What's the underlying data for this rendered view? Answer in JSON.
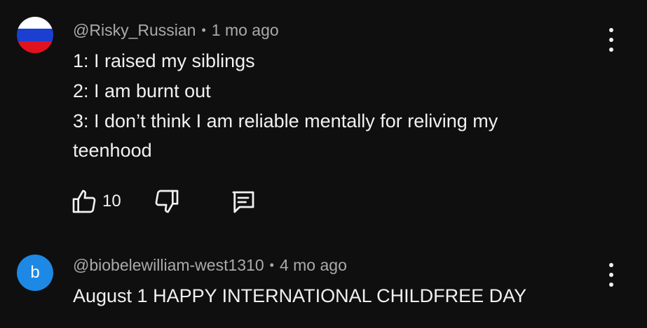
{
  "comments": [
    {
      "author": "@Risky_Russian",
      "time": "1 mo ago",
      "lines": [
        "1: I raised my siblings",
        "2: I am burnt out",
        "3: I don’t think I am reliable mentally for reliving my",
        "teenhood"
      ],
      "likes": "10",
      "avatar": {
        "type": "flag",
        "colors": [
          "#ffffff",
          "#1a3fd1",
          "#e0121f"
        ]
      }
    },
    {
      "author": "@biobelewilliam-west1310",
      "time": "4 mo ago",
      "lines": [
        "August 1 HAPPY INTERNATIONAL CHILDFREE DAY"
      ],
      "avatar": {
        "type": "letter",
        "letter": "b",
        "color": "#1e88e5"
      }
    }
  ],
  "separator": "•",
  "icons": {
    "like": "thumbs-up-icon",
    "dislike": "thumbs-down-icon",
    "reply": "reply-comment-icon",
    "more": "more-vertical-icon"
  }
}
